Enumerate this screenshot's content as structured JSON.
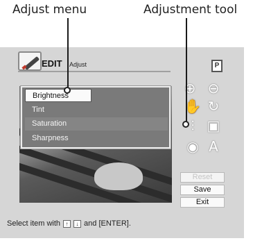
{
  "callouts": {
    "adjust_menu": "Adjust menu",
    "adjustment_tool": "Adjustment tool"
  },
  "header": {
    "title": "EDIT",
    "subtitle": "Adjust"
  },
  "menu": {
    "items": [
      {
        "label": "Brightness",
        "selected": true
      },
      {
        "label": "Tint",
        "selected": false
      },
      {
        "label": "Saturation",
        "selected": false
      },
      {
        "label": "Sharpness",
        "selected": false
      }
    ]
  },
  "tools": {
    "print_label": "P",
    "text_tool_label": "A"
  },
  "actions": {
    "reset": "Reset",
    "save": "Save",
    "exit": "Exit"
  },
  "status": {
    "prefix": "Select item with",
    "key_up": "↑",
    "key_down": "↓",
    "suffix": "and [ENTER]."
  },
  "colors": {
    "screen_bg": "#d6d6d6",
    "menu_bg": "#7a7a7a",
    "icon_white": "#ffffff"
  }
}
